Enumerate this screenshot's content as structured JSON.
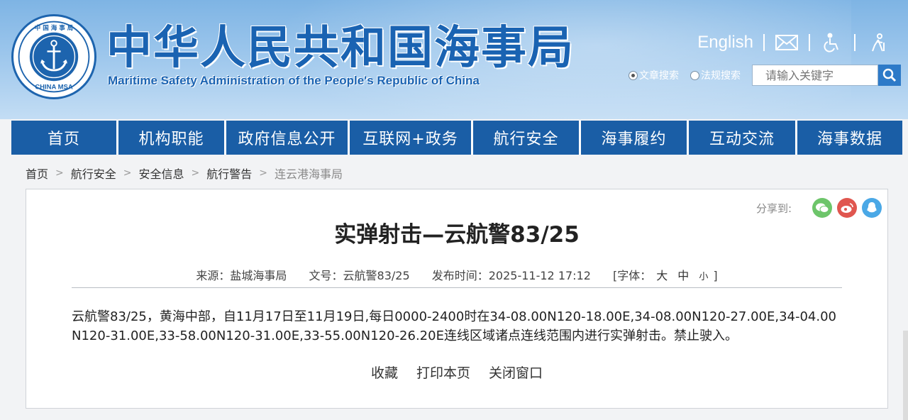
{
  "header": {
    "emblem_text": "中国海事局 CHINA MSA",
    "title_cn": "中华人民共和国海事局",
    "title_en": "Maritime Safety Administration of the People's Republic of China",
    "language_link": "English",
    "icons": [
      "mail-icon",
      "accessibility-icon",
      "elderly-mode-icon"
    ],
    "search": {
      "options": [
        {
          "label": "文章搜索",
          "checked": true
        },
        {
          "label": "法规搜索",
          "checked": false
        }
      ],
      "placeholder": "请输入关键字"
    }
  },
  "nav": {
    "items": [
      {
        "label": "首页"
      },
      {
        "label": "机构职能"
      },
      {
        "label": "政府信息公开"
      },
      {
        "label": "互联网+政务"
      },
      {
        "label": "航行安全"
      },
      {
        "label": "海事履约"
      },
      {
        "label": "互动交流"
      },
      {
        "label": "海事数据"
      }
    ]
  },
  "breadcrumb": {
    "items": [
      "首页",
      "航行安全",
      "安全信息",
      "航行警告",
      "连云港海事局"
    ],
    "separator": ">"
  },
  "article": {
    "share_label": "分享到:",
    "title": "实弹射击—云航警83/25",
    "meta": {
      "source": "来源：盐城海事局",
      "doc_no": "文号：云航警83/25",
      "publish_time": "发布时间：2025-11-12 17:12",
      "font_label": "[字体：",
      "font_large": "大",
      "font_medium": "中",
      "font_small": "小",
      "font_close": "]"
    },
    "body": "云航警83/25，黄海中部，自11月17日至11月19日,每日0000-2400时在34-08.00N120-18.00E,34-08.00N120-27.00E,34-04.00N120-31.00E,33-58.00N120-31.00E,33-55.00N120-26.20E连线区域诸点连线范围内进行实弹射击。禁止驶入。",
    "actions": [
      "收藏",
      "打印本页",
      "关闭窗口"
    ]
  },
  "colors": {
    "brand_blue": "#1a5ea6",
    "title_blue": "#1a63b2"
  }
}
